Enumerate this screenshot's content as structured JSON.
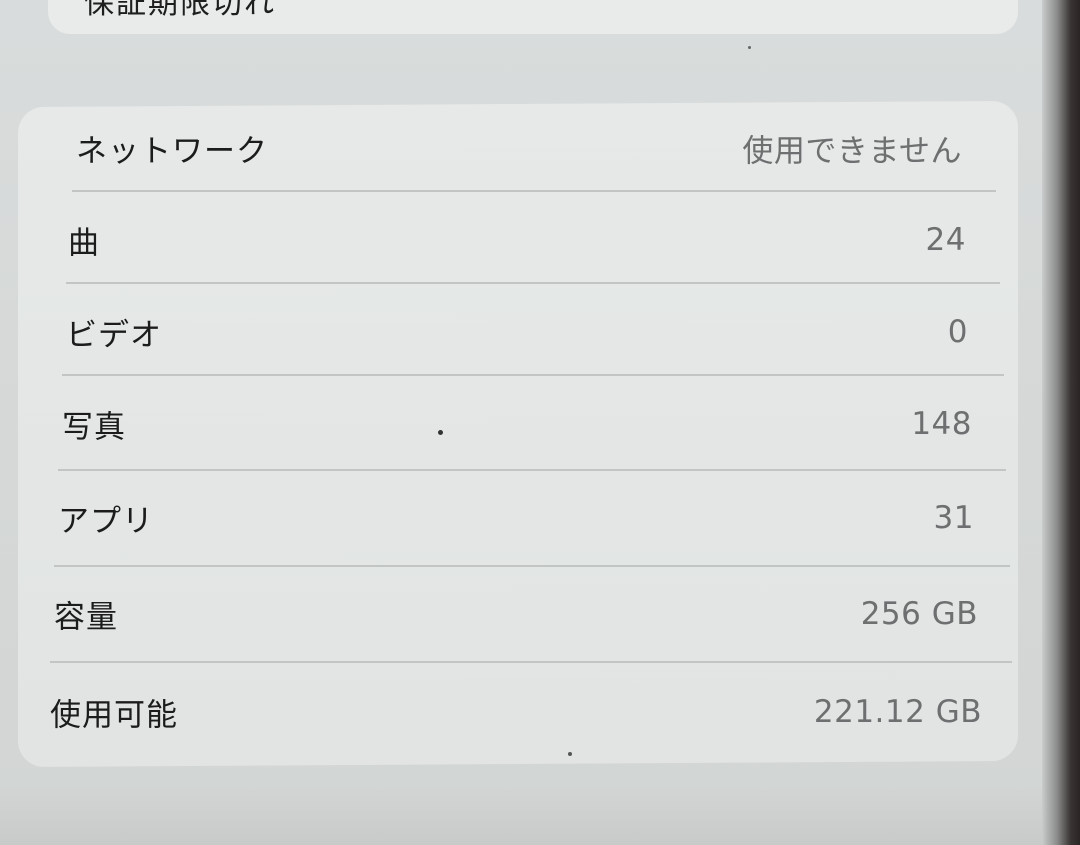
{
  "top_card": {
    "partial_text": "保証期限切れ"
  },
  "rows": [
    {
      "label": "ネットワーク",
      "value": "使用できません"
    },
    {
      "label": "曲",
      "value": "24"
    },
    {
      "label": "ビデオ",
      "value": "0"
    },
    {
      "label": "写真",
      "value": "148"
    },
    {
      "label": "アプリ",
      "value": "31"
    },
    {
      "label": "容量",
      "value": "256 GB"
    },
    {
      "label": "使用可能",
      "value": "221.12 GB"
    }
  ]
}
